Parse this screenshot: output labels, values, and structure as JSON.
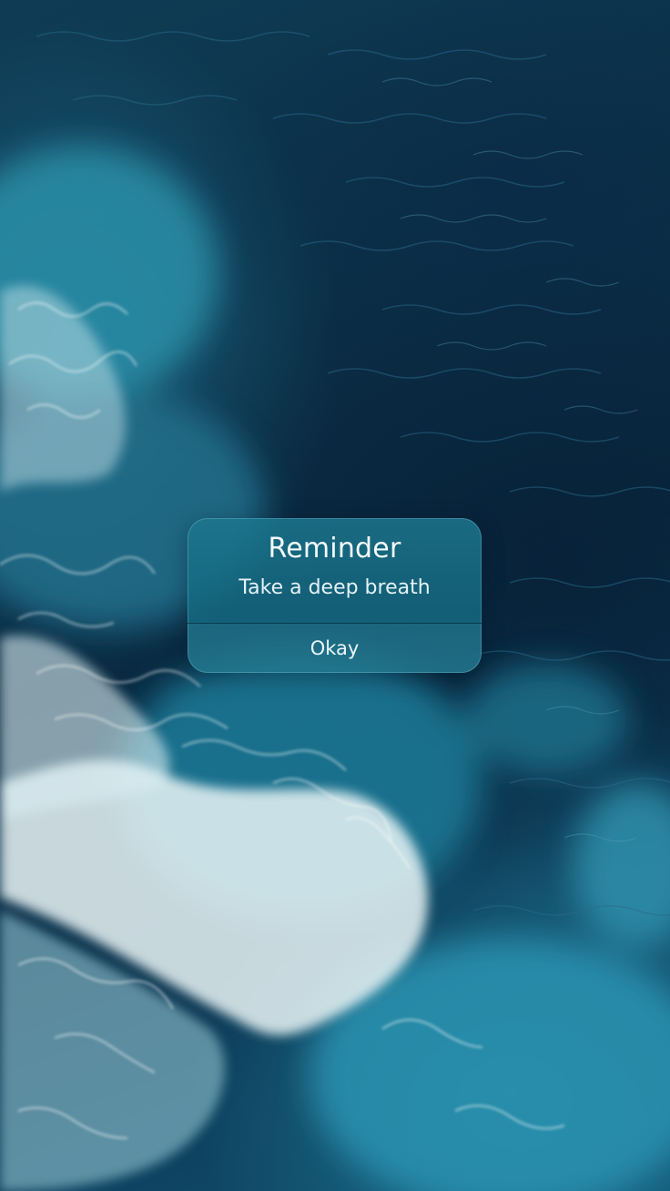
{
  "wallpaper": {
    "subject": "aerial ocean waves",
    "colors": {
      "deep_water": "#0a2a42",
      "mid_water": "#115170",
      "turquoise": "#2a90aa",
      "foam": "#ffffff"
    }
  },
  "alert": {
    "title": "Reminder",
    "message": "Take a deep breath",
    "button_label": "Okay",
    "colors": {
      "background": "#1a6e88",
      "text": "#f3fbfd",
      "divider": "#083242"
    }
  }
}
